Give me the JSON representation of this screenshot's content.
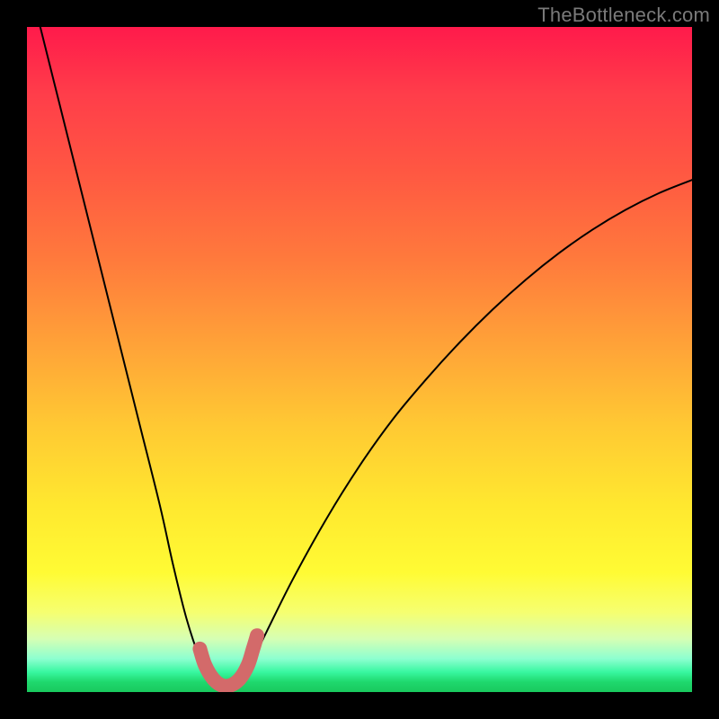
{
  "watermark": "TheBottleneck.com",
  "chart_data": {
    "type": "line",
    "title": "",
    "xlabel": "",
    "ylabel": "",
    "xlim": [
      0,
      100
    ],
    "ylim": [
      0,
      100
    ],
    "grid": false,
    "series": [
      {
        "name": "bottleneck-curve",
        "x": [
          2,
          5,
          8,
          11,
          14,
          17,
          20,
          22,
          24,
          26,
          27.5,
          29,
          30.5,
          32,
          34,
          36,
          40,
          45,
          50,
          55,
          60,
          65,
          70,
          75,
          80,
          85,
          90,
          95,
          100
        ],
        "y": [
          100,
          88,
          76,
          64,
          52,
          40,
          28,
          19,
          11,
          5,
          2,
          1,
          1,
          2,
          5,
          9,
          17,
          26,
          34,
          41,
          47,
          52.5,
          57.5,
          62,
          66,
          69.5,
          72.5,
          75,
          77
        ]
      },
      {
        "name": "marker-u",
        "x": [
          26,
          26.8,
          28,
          29.3,
          30.6,
          32,
          33.2,
          34,
          34.6
        ],
        "y": [
          6.5,
          4,
          2,
          1,
          1,
          2,
          4,
          6.5,
          8.5
        ]
      }
    ],
    "gradient_stops": [
      {
        "pos": 0,
        "color": "#ff1a4b"
      },
      {
        "pos": 50,
        "color": "#ffa338"
      },
      {
        "pos": 80,
        "color": "#fffb34"
      },
      {
        "pos": 100,
        "color": "#19c95e"
      }
    ]
  }
}
